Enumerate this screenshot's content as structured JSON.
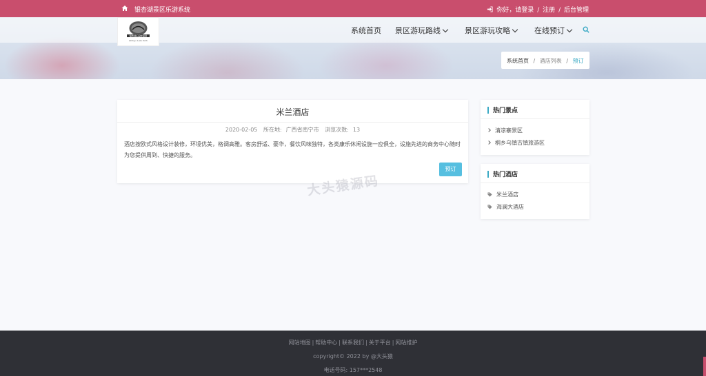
{
  "topbar": {
    "site_title": "银杏湖景区乐游系统",
    "greeting": "你好，请登录",
    "register": "注册",
    "admin": "后台管理",
    "sep": "/"
  },
  "logo": {
    "text": "银杏湖乐园欢迎您",
    "subtext": "Ginkgo Lake Park"
  },
  "nav": {
    "items": [
      {
        "label": "系统首页"
      },
      {
        "label": "景区游玩路线"
      },
      {
        "label": "景区游玩攻略"
      },
      {
        "label": "在线预订"
      }
    ]
  },
  "breadcrumb": {
    "home": "系统首页",
    "list": "酒店列表",
    "current": "预订",
    "sep": "/"
  },
  "hotel": {
    "name": "米兰酒店",
    "date": "2020-02-05",
    "location_label": "所在地:",
    "location": "广西省南宁市",
    "views_label": "浏览次数:",
    "views": "13",
    "description": "酒店按欧式风格设计装修，环境优美，格调高雅。客房舒适、豪华，餐饮风味独特，各类康乐休闲设施一应俱全，设施先进的商务中心随时为您提供周到、快捷的服务。",
    "book_button": "预订"
  },
  "sidebar": {
    "attractions": {
      "title": "热门景点",
      "items": [
        {
          "label": "清凉寨景区"
        },
        {
          "label": "桐乡乌镇古镇旅游区"
        }
      ]
    },
    "hotels": {
      "title": "热门酒店",
      "items": [
        {
          "label": "米兰酒店"
        },
        {
          "label": "海澜大酒店"
        }
      ]
    }
  },
  "watermark": "大头猿源码",
  "footer": {
    "links": [
      "网站地图",
      "帮助中心",
      "联系我们",
      "关于平台",
      "网站维护"
    ],
    "link_sep": "|",
    "copyright": "copyright© 2022 by @大头猿",
    "phone": "电话号码:  157***2548"
  },
  "colors": {
    "topbar": "#c94e6d",
    "accent": "#3aa9c4",
    "button": "#56bfe0",
    "footer": "#2f3036"
  }
}
